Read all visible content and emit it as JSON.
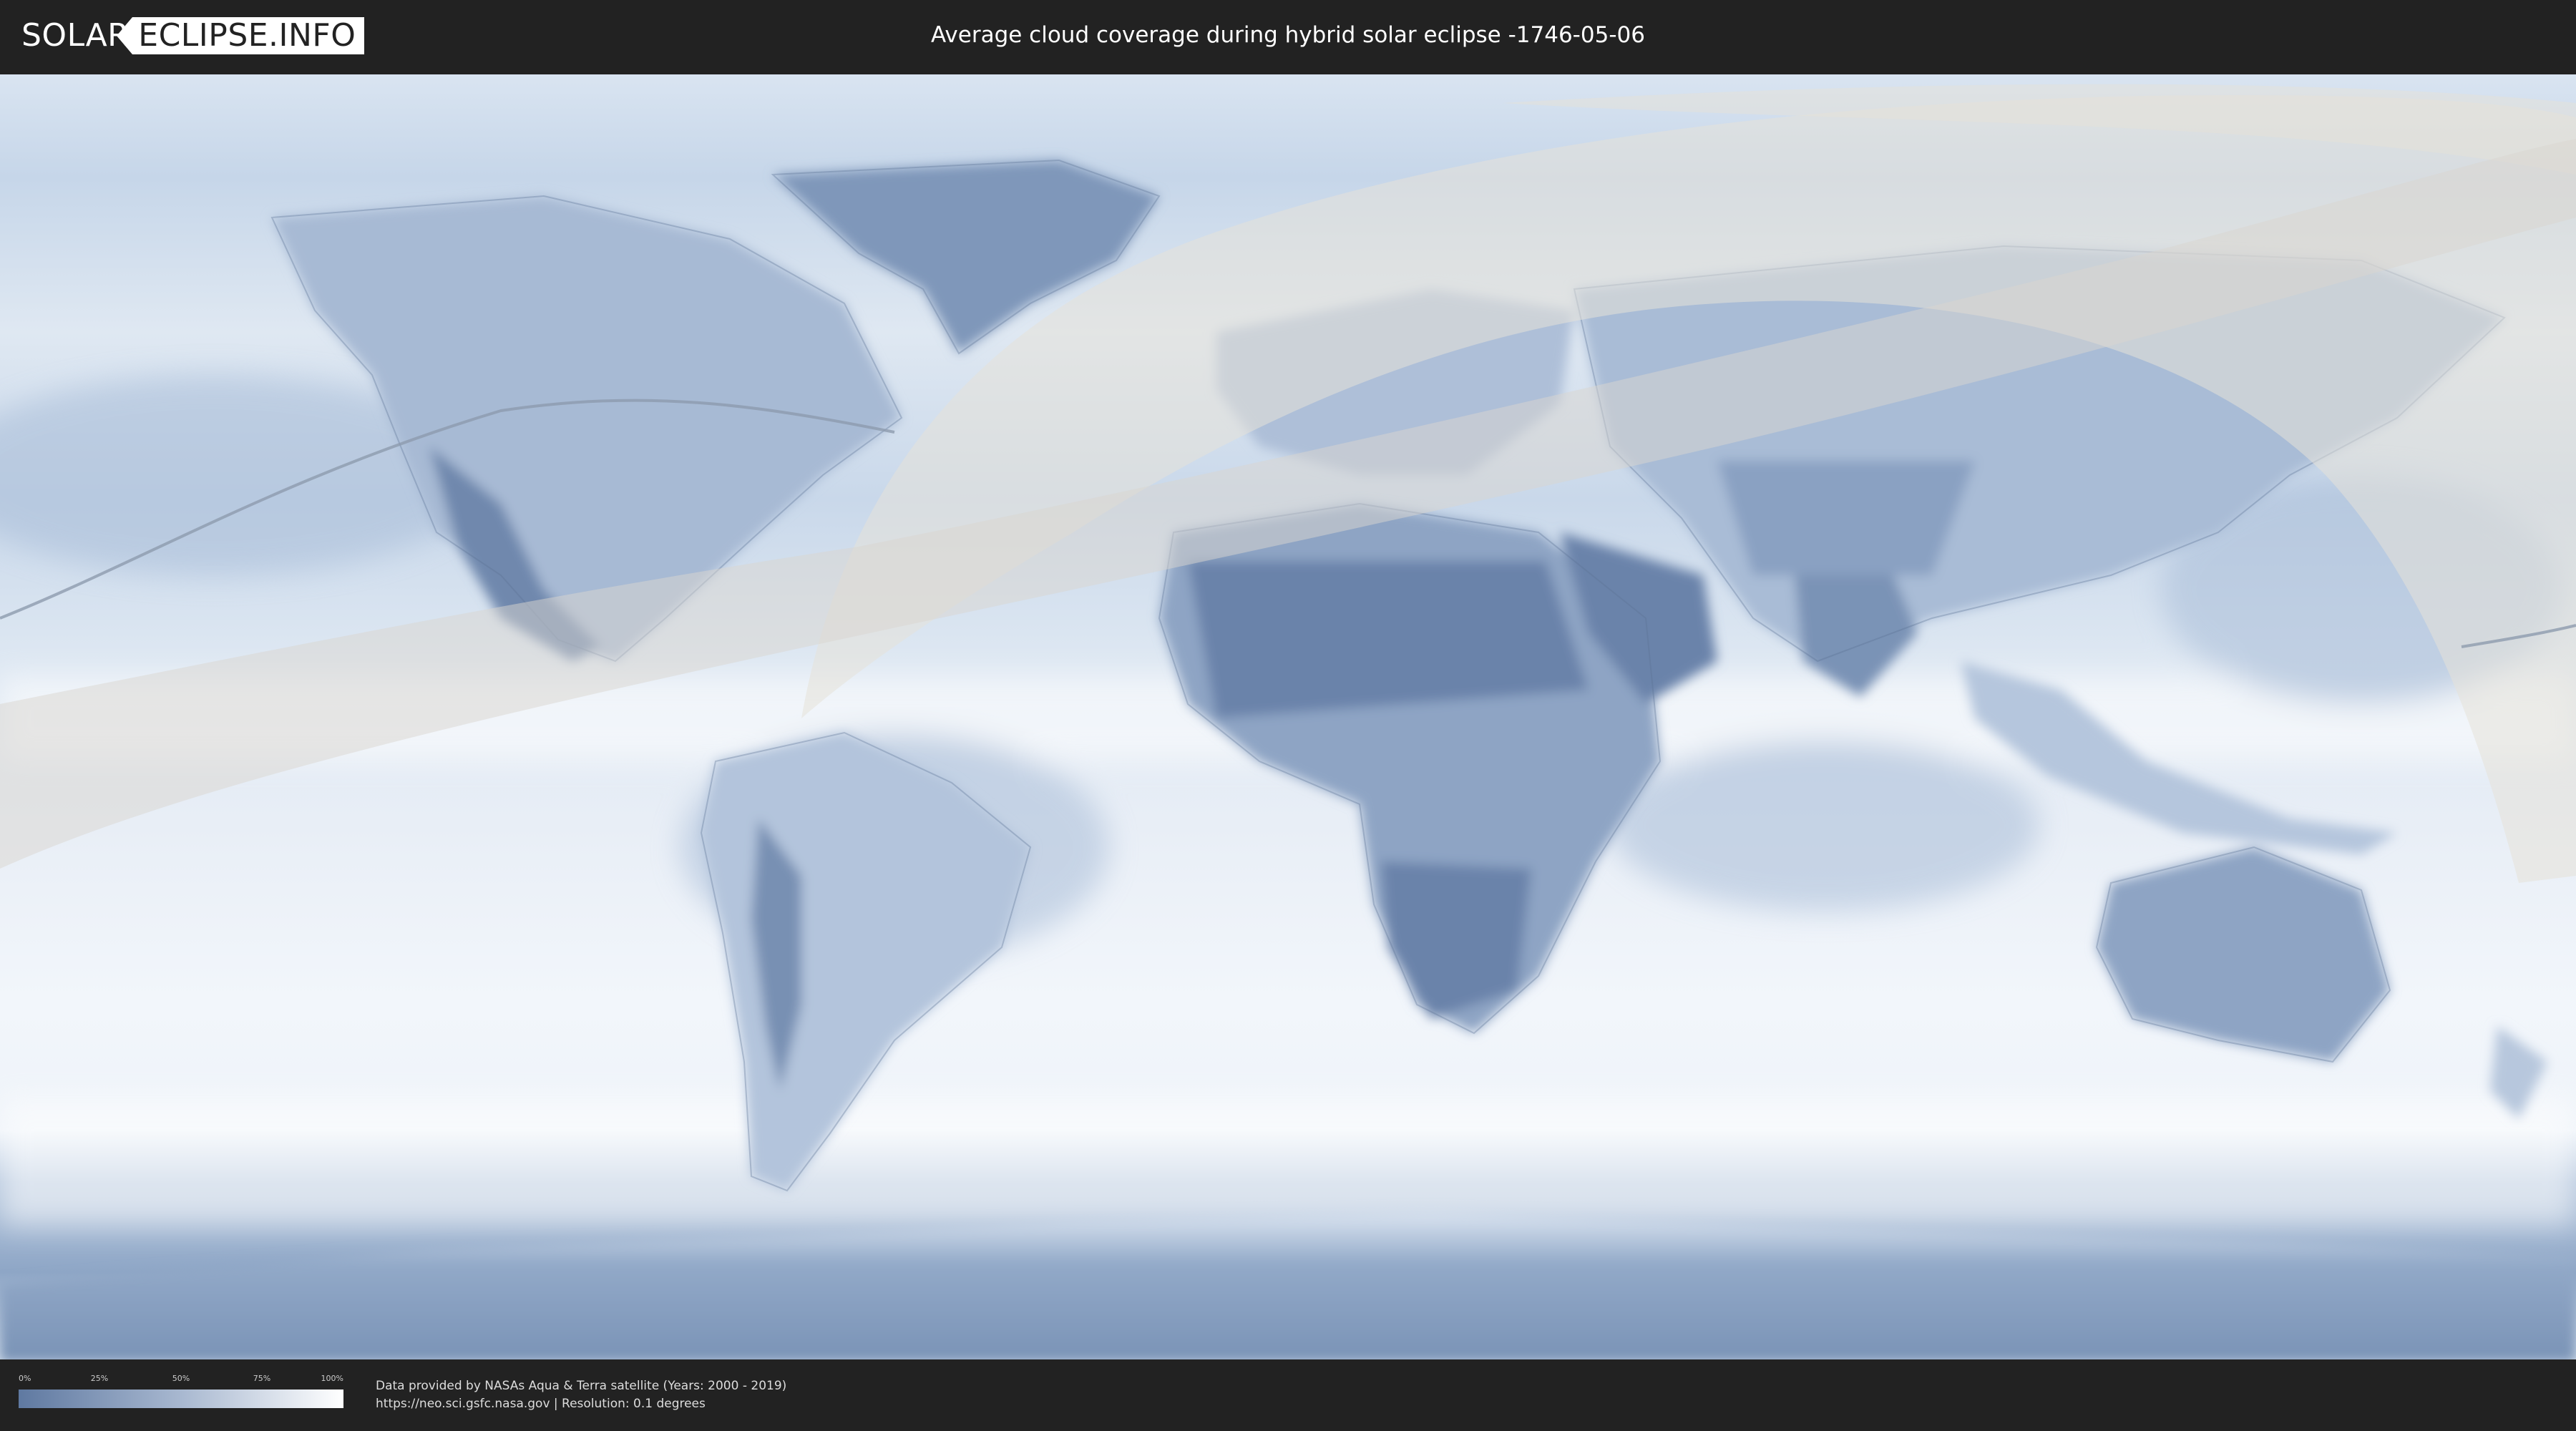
{
  "header": {
    "logo_left": "SOLAR",
    "logo_right": "ECLIPSE.INFO",
    "title": "Average cloud coverage during hybrid solar eclipse -1746-05-06"
  },
  "map": {
    "subject": "world cloud coverage map with eclipse visibility zone",
    "colors": {
      "clear": "#5f79a1",
      "mid": "#a3b7d1",
      "cloudy": "#f4f7fb",
      "eclipse_zone": "#e6e1d8",
      "eclipse_path": "#b7a98a"
    }
  },
  "legend": {
    "ticks": [
      "0%",
      "25%",
      "50%",
      "75%",
      "100%"
    ],
    "gradient": [
      "#5f79a1",
      "#a8b8d0",
      "#ffffff"
    ]
  },
  "credits": {
    "line1": "Data provided by NASAs Aqua & Terra satellite (Years: 2000 - 2019)",
    "line2": "https://neo.sci.gsfc.nasa.gov | Resolution: 0.1 degrees"
  }
}
